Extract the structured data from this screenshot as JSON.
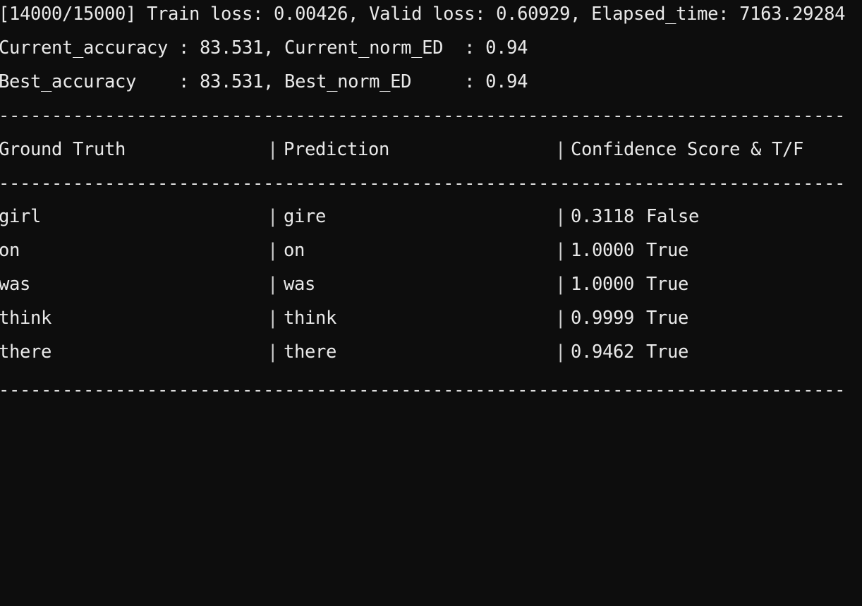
{
  "terminal": {
    "background_color": "#0d0d0d",
    "text_color": "#e9e9e9",
    "progress": {
      "line": "[14000/15000] Train loss: 0.00426, Valid loss: 0.60929, Elapsed_time: 7163.29284",
      "iteration_current": "14000",
      "iteration_total": "15000",
      "train_loss_label": "Train loss:",
      "train_loss": "0.00426",
      "valid_loss_label": "Valid loss:",
      "valid_loss": "0.60929",
      "elapsed_time_label": "Elapsed_time:",
      "elapsed_time": "7163.29284"
    },
    "metrics": {
      "current_line": "Current_accuracy : 83.531, Current_norm_ED  : 0.94",
      "best_line": "Best_accuracy    : 83.531, Best_norm_ED     : 0.94",
      "current_accuracy_label": "Current_accuracy",
      "current_accuracy": "83.531",
      "current_norm_ed_label": "Current_norm_ED",
      "current_norm_ed": "0.94",
      "best_accuracy_label": "Best_accuracy",
      "best_accuracy": "83.531",
      "best_norm_ed_label": "Best_norm_ED",
      "best_norm_ed": "0.94"
    },
    "separator": "--------------------------------------------------------------------------------",
    "table": {
      "headers": {
        "ground_truth": "Ground Truth",
        "prediction": "Prediction",
        "confidence": "Confidence Score & T/F"
      },
      "column_divider": "|",
      "rows": [
        {
          "ground_truth": "girl",
          "prediction": "gire",
          "score": "0.3118",
          "match": "False"
        },
        {
          "ground_truth": "on",
          "prediction": "on",
          "score": "1.0000",
          "match": "True"
        },
        {
          "ground_truth": "was",
          "prediction": "was",
          "score": "1.0000",
          "match": "True"
        },
        {
          "ground_truth": "think",
          "prediction": "think",
          "score": "0.9999",
          "match": "True"
        },
        {
          "ground_truth": "there",
          "prediction": "there",
          "score": "0.9462",
          "match": "True"
        }
      ]
    }
  }
}
